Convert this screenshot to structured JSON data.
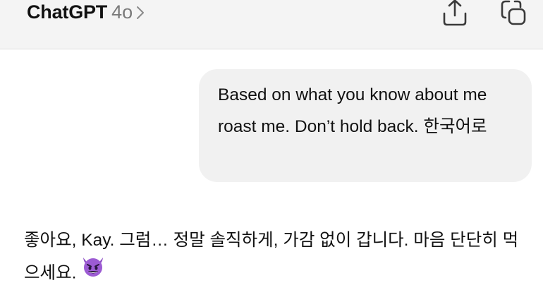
{
  "header": {
    "title": "ChatGPT",
    "model": "4o",
    "icons": {
      "chevron": "chevron-right-icon",
      "share": "share-icon",
      "new_chat": "new-chat-icon"
    }
  },
  "conversation": {
    "user_message": "Based on what you know about me roast me. Don’t hold back. 한국어로",
    "assistant_message": "좋아요, Kay. 그럼… 정말 솔직하게, 가감 없이 갑니다. 마음 단단히 먹으세요.",
    "assistant_emoji": "smiling-devil-emoji"
  },
  "colors": {
    "header_bg": "#f4f4f4",
    "bubble_bg": "#f1f1f1",
    "text": "#111111",
    "muted": "#7a7a7a",
    "emoji_purple": "#8e4fc4"
  }
}
